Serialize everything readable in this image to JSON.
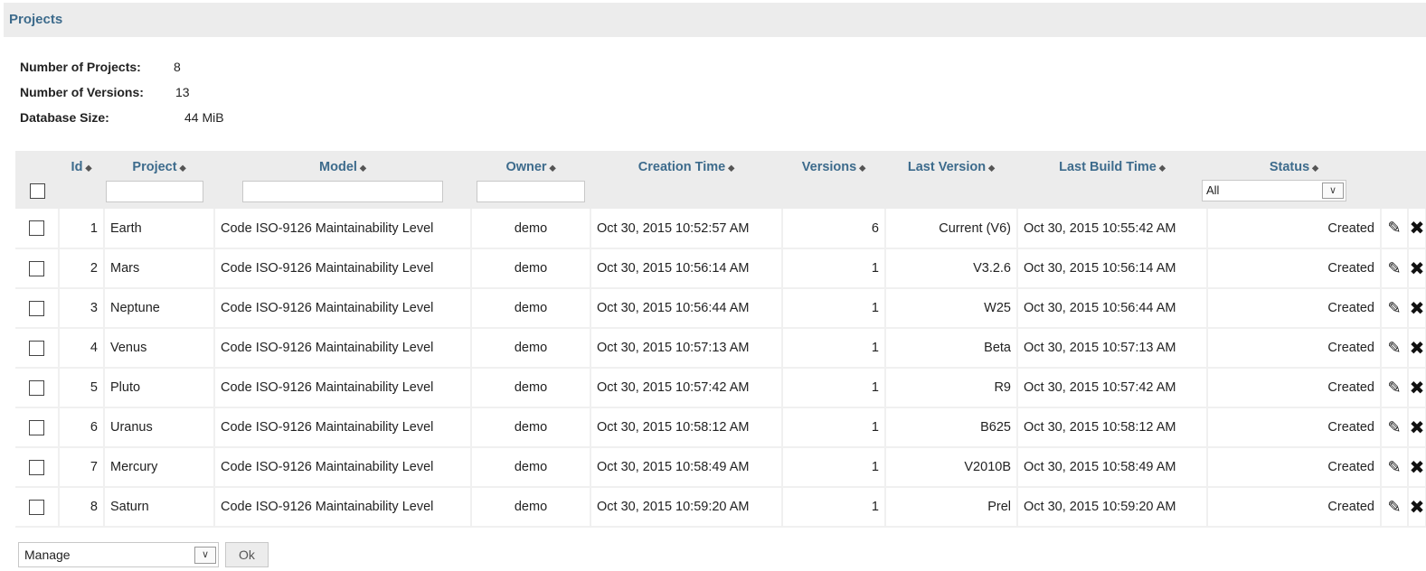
{
  "page": {
    "title": "Projects"
  },
  "stats": {
    "projects_label": "Number of Projects:",
    "projects_value": "8",
    "versions_label": "Number of Versions:",
    "versions_value": "13",
    "dbsize_label": "Database Size:",
    "dbsize_value": "44 MiB"
  },
  "table": {
    "sort_glyph": "⬥",
    "columns": {
      "id": "Id",
      "project": "Project",
      "model": "Model",
      "owner": "Owner",
      "creation_time": "Creation Time",
      "versions": "Versions",
      "last_version": "Last Version",
      "last_build_time": "Last Build Time",
      "status": "Status"
    },
    "status_filter": "All",
    "edit_icon": "pencil-icon",
    "delete_icon": "delete-icon",
    "rows": [
      {
        "id": "1",
        "project": "Earth",
        "model": "Code ISO-9126 Maintainability Level",
        "owner": "demo",
        "creation_time": "Oct 30, 2015 10:52:57 AM",
        "versions": "6",
        "last_version": "Current (V6)",
        "last_build_time": "Oct 30, 2015 10:55:42 AM",
        "status": "Created"
      },
      {
        "id": "2",
        "project": "Mars",
        "model": "Code ISO-9126 Maintainability Level",
        "owner": "demo",
        "creation_time": "Oct 30, 2015 10:56:14 AM",
        "versions": "1",
        "last_version": "V3.2.6",
        "last_build_time": "Oct 30, 2015 10:56:14 AM",
        "status": "Created"
      },
      {
        "id": "3",
        "project": "Neptune",
        "model": "Code ISO-9126 Maintainability Level",
        "owner": "demo",
        "creation_time": "Oct 30, 2015 10:56:44 AM",
        "versions": "1",
        "last_version": "W25",
        "last_build_time": "Oct 30, 2015 10:56:44 AM",
        "status": "Created"
      },
      {
        "id": "4",
        "project": "Venus",
        "model": "Code ISO-9126 Maintainability Level",
        "owner": "demo",
        "creation_time": "Oct 30, 2015 10:57:13 AM",
        "versions": "1",
        "last_version": "Beta",
        "last_build_time": "Oct 30, 2015 10:57:13 AM",
        "status": "Created"
      },
      {
        "id": "5",
        "project": "Pluto",
        "model": "Code ISO-9126 Maintainability Level",
        "owner": "demo",
        "creation_time": "Oct 30, 2015 10:57:42 AM",
        "versions": "1",
        "last_version": "R9",
        "last_build_time": "Oct 30, 2015 10:57:42 AM",
        "status": "Created"
      },
      {
        "id": "6",
        "project": "Uranus",
        "model": "Code ISO-9126 Maintainability Level",
        "owner": "demo",
        "creation_time": "Oct 30, 2015 10:58:12 AM",
        "versions": "1",
        "last_version": "B625",
        "last_build_time": "Oct 30, 2015 10:58:12 AM",
        "status": "Created"
      },
      {
        "id": "7",
        "project": "Mercury",
        "model": "Code ISO-9126 Maintainability Level",
        "owner": "demo",
        "creation_time": "Oct 30, 2015 10:58:49 AM",
        "versions": "1",
        "last_version": "V2010B",
        "last_build_time": "Oct 30, 2015 10:58:49 AM",
        "status": "Created"
      },
      {
        "id": "8",
        "project": "Saturn",
        "model": "Code ISO-9126 Maintainability Level",
        "owner": "demo",
        "creation_time": "Oct 30, 2015 10:59:20 AM",
        "versions": "1",
        "last_version": "Prel",
        "last_build_time": "Oct 30, 2015 10:59:20 AM",
        "status": "Created"
      }
    ]
  },
  "footer": {
    "action_select": "Manage",
    "ok_label": "Ok"
  }
}
